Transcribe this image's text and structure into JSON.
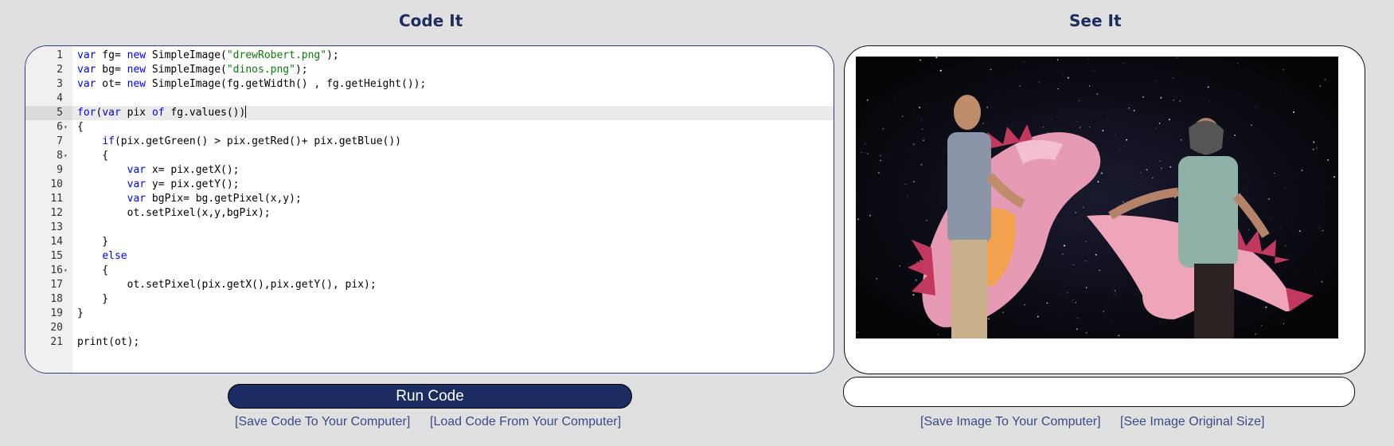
{
  "headings": {
    "code": "Code It",
    "see": "See It"
  },
  "editor": {
    "active_line": 5,
    "lines": [
      {
        "n": "1",
        "fold": "",
        "html": "<span class='kw'>var</span> fg= <span class='kw'>new</span> SimpleImage(<span class='str'>\"drewRobert.png\"</span>);"
      },
      {
        "n": "2",
        "fold": "",
        "html": "<span class='kw'>var</span> bg= <span class='kw'>new</span> SimpleImage(<span class='str'>\"dinos.png\"</span>);"
      },
      {
        "n": "3",
        "fold": "",
        "html": "<span class='kw'>var</span> ot= <span class='kw'>new</span> SimpleImage(fg.getWidth() , fg.getHeight());"
      },
      {
        "n": "4",
        "fold": "",
        "html": ""
      },
      {
        "n": "5",
        "fold": "",
        "html": "<span class='kw'>for</span>(<span class='kw'>var</span> pix <span class='kw'>of</span> fg.values())<span class='cursor'></span>"
      },
      {
        "n": "6",
        "fold": "▾",
        "html": "{"
      },
      {
        "n": "7",
        "fold": "",
        "html": "    <span class='kw'>if</span>(pix.getGreen() &gt; pix.getRed()+ pix.getBlue())"
      },
      {
        "n": "8",
        "fold": "▾",
        "html": "    {"
      },
      {
        "n": "9",
        "fold": "",
        "html": "        <span class='kw'>var</span> x= pix.getX();"
      },
      {
        "n": "10",
        "fold": "",
        "html": "        <span class='kw'>var</span> y= pix.getY();"
      },
      {
        "n": "11",
        "fold": "",
        "html": "        <span class='kw'>var</span> bgPix= bg.getPixel(x,y);"
      },
      {
        "n": "12",
        "fold": "",
        "html": "        ot.setPixel(x,y,bgPix);"
      },
      {
        "n": "13",
        "fold": "",
        "html": ""
      },
      {
        "n": "14",
        "fold": "",
        "html": "    }"
      },
      {
        "n": "15",
        "fold": "",
        "html": "    <span class='kw'>else</span>"
      },
      {
        "n": "16",
        "fold": "▾",
        "html": "    {"
      },
      {
        "n": "17",
        "fold": "",
        "html": "        ot.setPixel(pix.getX(),pix.getY(), pix);"
      },
      {
        "n": "18",
        "fold": "",
        "html": "    }"
      },
      {
        "n": "19",
        "fold": "",
        "html": "}"
      },
      {
        "n": "20",
        "fold": "",
        "html": ""
      },
      {
        "n": "21",
        "fold": "",
        "html": "print(ot);"
      }
    ]
  },
  "run_button": "Run Code",
  "links": {
    "save_code": "[Save Code To Your Computer]",
    "load_code": "[Load Code From Your Computer]",
    "save_image": "[Save Image To Your Computer]",
    "original_size": "[See Image Original Size]"
  },
  "colors": {
    "heading": "#1c2d5e",
    "button": "#1c2d64",
    "link": "#3a4a8a"
  }
}
